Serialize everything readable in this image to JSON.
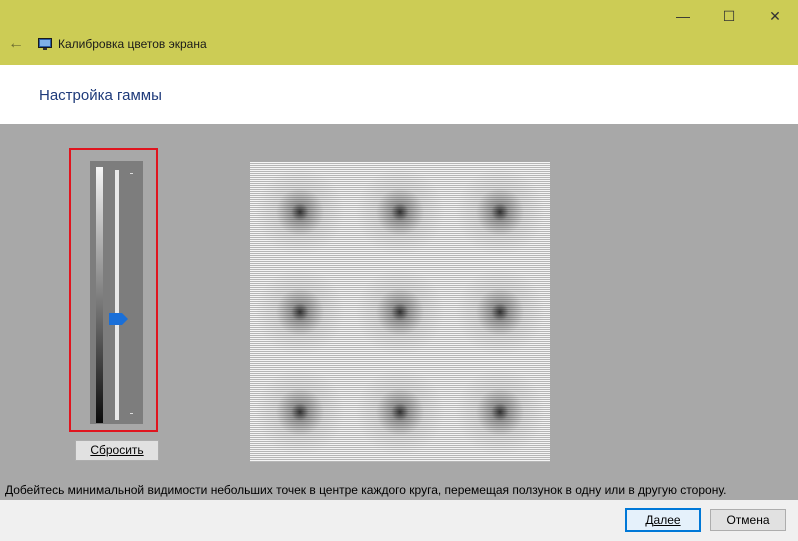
{
  "window": {
    "title": "Калибровка цветов экрана",
    "minimize_glyph": "—",
    "maximize_glyph": "☐",
    "close_glyph": "✕",
    "back_glyph": "←"
  },
  "page": {
    "heading": "Настройка гаммы"
  },
  "gamma_slider": {
    "level": 0.4,
    "highlight_color": "#e0141e",
    "thumb_color": "#1a6fd8"
  },
  "reset_button": {
    "label_first": "С",
    "label_rest": "бросить"
  },
  "test_pattern": {
    "rows": 3,
    "cols": 3
  },
  "instruction": "Добейтесь минимальной видимости небольших точек в центре каждого круга, перемещая ползунок в одну или в другую сторону.",
  "footer": {
    "next_first": "Д",
    "next_rest": "алее",
    "cancel_label": "Отмена"
  },
  "colors": {
    "titlebar": "#cccc55",
    "heading": "#1e3a7a",
    "content_bg": "#a8a8a8"
  },
  "icons": [
    "back-arrow-icon",
    "display-icon",
    "minimize-icon",
    "maximize-icon",
    "close-icon"
  ]
}
